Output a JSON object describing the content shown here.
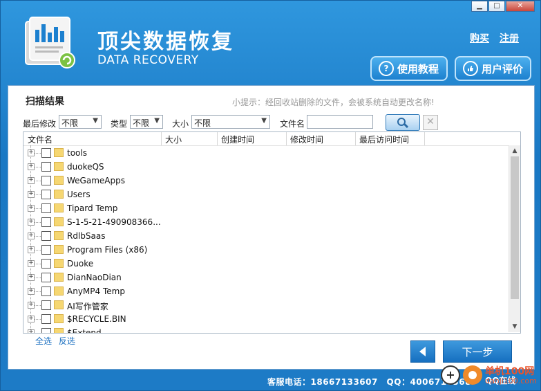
{
  "window": {
    "min": "▁",
    "max": "□",
    "close": "✕"
  },
  "header": {
    "title": "顶尖数据恢复",
    "subtitle": "DATA RECOVERY",
    "buy": "购买",
    "register": "注册",
    "tutorial": "使用教程",
    "review": "用户评价",
    "tutorial_icon": "?"
  },
  "panel": {
    "title": "扫描结果",
    "tip": "小提示：经回收站删除的文件，会被系统自动更改名称!",
    "filters": {
      "modified_label": "最后修改",
      "modified_value": "不限",
      "type_label": "类型",
      "type_value": "不限",
      "size_label": "大小",
      "size_value": "不限",
      "filename_label": "文件名",
      "filename_value": ""
    },
    "columns": [
      "文件名",
      "大小",
      "创建时间",
      "修改时间",
      "最后访问时间"
    ],
    "rows": [
      "tools",
      "duokeQS",
      "WeGameApps",
      "Users",
      "Tipard Temp",
      "S-1-5-21-490908366...",
      "RdlbSaas",
      "Program Files (x86)",
      "Duoke",
      "DianNaoDian",
      "AnyMP4 Temp",
      "AI写作管家",
      "$RECYCLE.BIN",
      "$Extend"
    ],
    "select_all": "全选",
    "invert": "反选",
    "next": "下一步"
  },
  "footer": {
    "hotline": "客服电话：18667133607",
    "qq": "QQ：4006718368",
    "qq_online": "QQ在线"
  },
  "watermark": {
    "line1": "单机100网",
    "line2": "danji100.com"
  },
  "colors": {
    "title_bar": "#1a78c4",
    "folder": "#f6d772",
    "link": "#1a6fc0",
    "watermark": "#e8552d"
  },
  "icons": {
    "logo": "bar-chart-document-icon",
    "search": "magnifier-icon",
    "back": "left-arrow-icon",
    "clear": "x-icon"
  }
}
